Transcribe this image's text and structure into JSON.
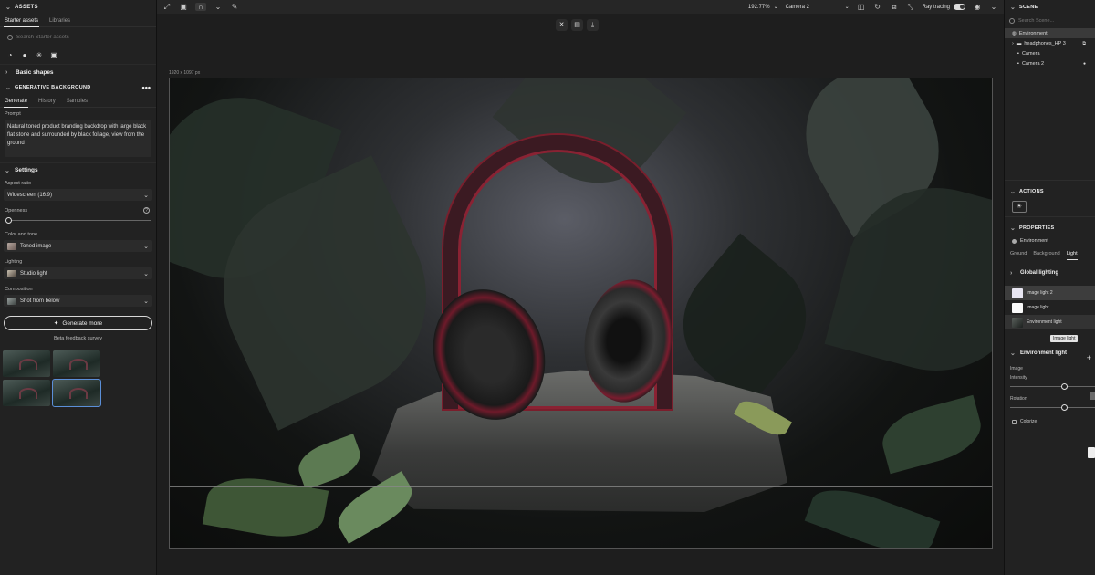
{
  "left": {
    "assets_title": "ASSETS",
    "tabs": [
      {
        "label": "Starter assets"
      },
      {
        "label": "Libraries"
      }
    ],
    "search_placeholder": "Search Starter assets",
    "icons": [
      "shape-icon",
      "sphere-icon",
      "light-icon",
      "image-icon",
      "list-icon"
    ],
    "basic_shapes": "Basic shapes",
    "generative_title": "GENERATIVE BACKGROUND",
    "gen_tabs": [
      {
        "label": "Generate"
      },
      {
        "label": "History"
      },
      {
        "label": "Samples"
      }
    ],
    "prompt_label": "Prompt",
    "prompt_text": "Natural toned product branding backdrop with large black flat stone and surrounded by black foliage, view from the ground",
    "settings_title": "Settings",
    "aspect_label": "Aspect ratio",
    "aspect_value": "Widescreen (16:9)",
    "openness_label": "Openness",
    "openness_value": 0,
    "color_label": "Color and tone",
    "color_value": "Toned image",
    "lighting_label": "Lighting",
    "lighting_value": "Studio light",
    "composition_label": "Composition",
    "composition_value": "Shot from below",
    "generate_button": "Generate more",
    "survey": "Beta feedback survey"
  },
  "toolbar": {
    "zoom": "192.77%",
    "camera": "Camera 2",
    "ray_tracing": "Ray tracing",
    "ray_tracing_on": true
  },
  "canvas": {
    "dimensions": "1920 x 1097 px"
  },
  "right": {
    "scene_title": "SCENE",
    "search_placeholder": "Search Scene...",
    "tree": [
      {
        "label": "Environment",
        "selected": true
      },
      {
        "label": "headphones_HP 3",
        "selected": false
      },
      {
        "label": "Camera",
        "selected": false
      },
      {
        "label": "Camera 2",
        "selected": false
      }
    ],
    "actions_title": "ACTIONS",
    "properties_title": "PROPERTIES",
    "properties_object": "Environment",
    "prop_tabs": [
      {
        "label": "Ground"
      },
      {
        "label": "Background"
      },
      {
        "label": "Light"
      }
    ],
    "global_lighting": "Global lighting",
    "lights": [
      {
        "label": "Image light 2"
      },
      {
        "label": "Image light"
      },
      {
        "label": "Environment light"
      }
    ],
    "tooltip": "Image light",
    "env_light_title": "Environment light",
    "image_label": "Image",
    "intensity_label": "Intensity",
    "rotation_label": "Rotation",
    "colorize_label": "Colorize"
  }
}
